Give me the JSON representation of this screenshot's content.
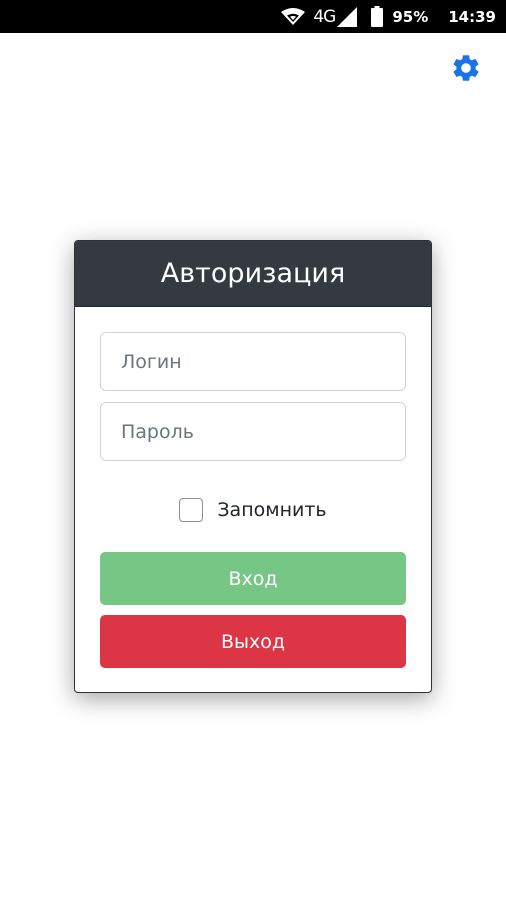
{
  "status_bar": {
    "network": "4G",
    "battery_percent": "95%",
    "time": "14:39",
    "battery_level": 0.95,
    "icons": [
      "wifi-icon",
      "signal-icon",
      "battery-icon"
    ]
  },
  "settings": {
    "icon": "gear-icon",
    "color": "#1a73e8"
  },
  "dialog": {
    "title": "Авторизация",
    "login_placeholder": "Логин",
    "login_value": "",
    "password_placeholder": "Пароль",
    "password_value": "",
    "remember_label": "Запомнить",
    "remember_checked": false,
    "login_button": "Вход",
    "exit_button": "Выход"
  },
  "colors": {
    "header_bg": "#343a40",
    "login_button": "#76c685",
    "exit_button": "#dc3545"
  }
}
